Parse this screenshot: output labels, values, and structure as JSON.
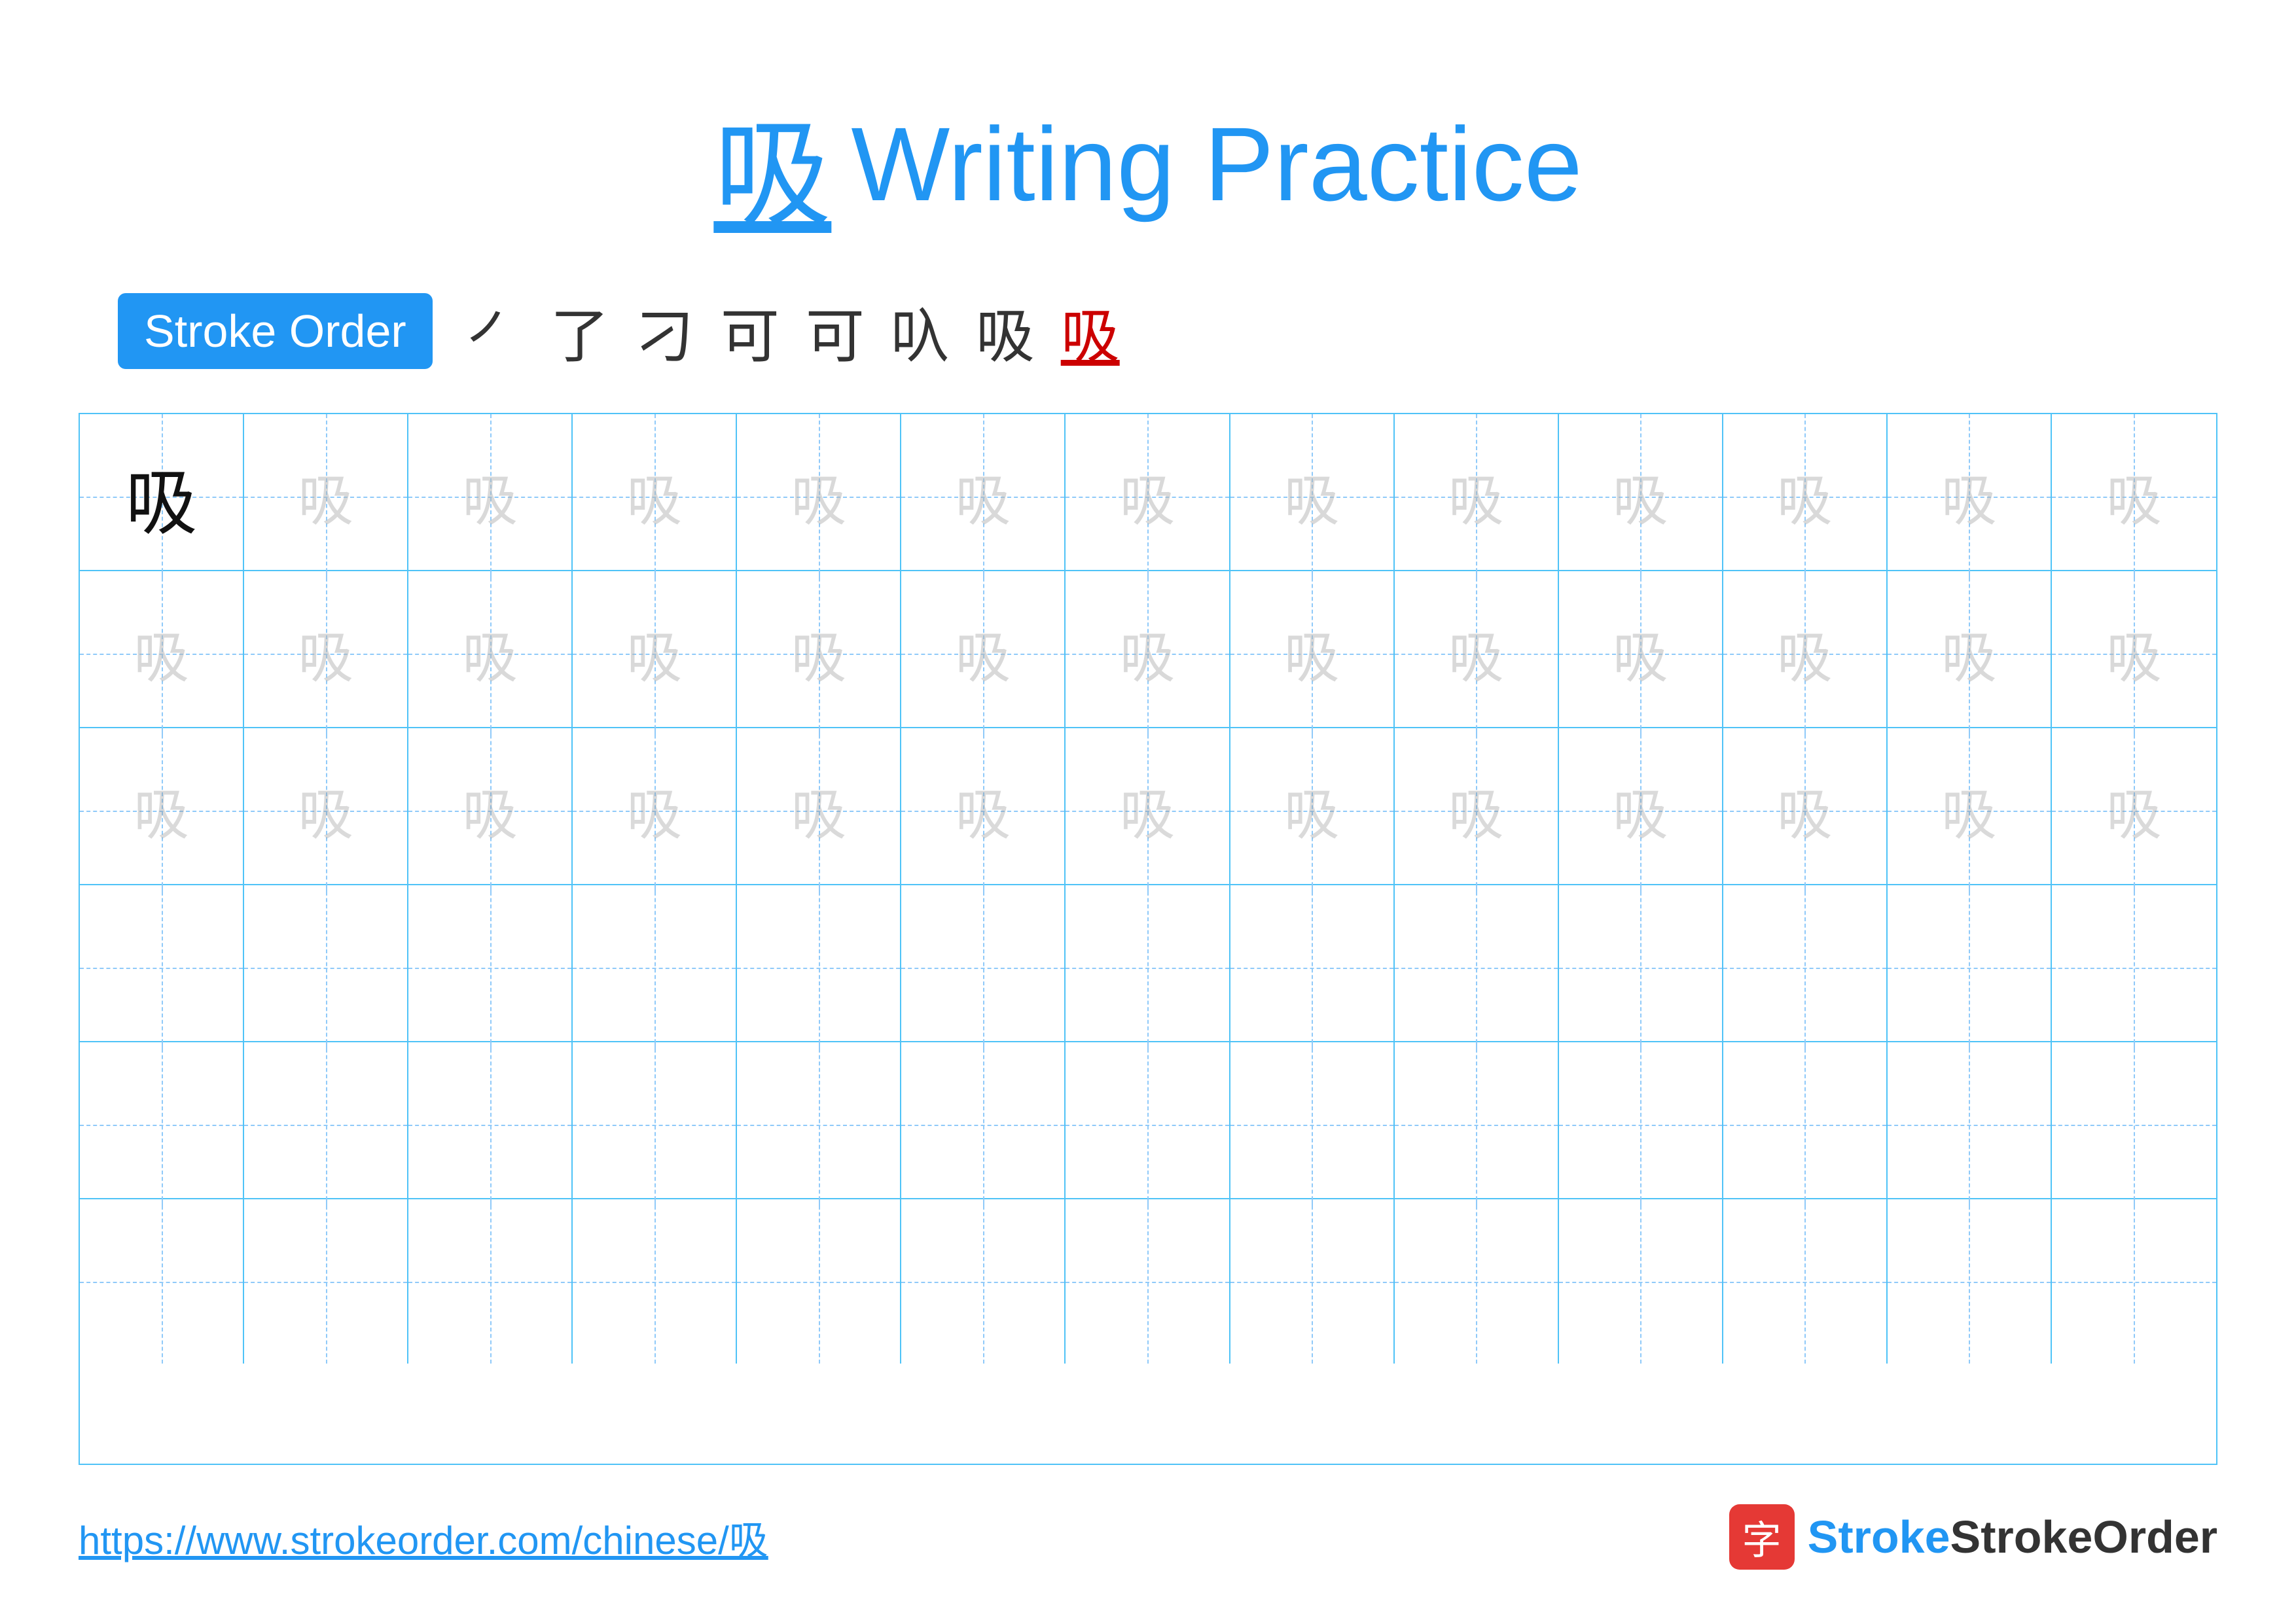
{
  "title": {
    "char": "吸",
    "label": "Writing Practice"
  },
  "stroke_order": {
    "badge_label": "Stroke Order",
    "steps": [
      "㇒",
      "了",
      "刁",
      "可",
      "可",
      "叺",
      "吸",
      "吸"
    ]
  },
  "grid": {
    "rows": 6,
    "cols": 13,
    "row1_type": "reference_ghost",
    "row2_type": "ghost",
    "row3_type": "light",
    "row4_type": "empty",
    "row5_type": "empty",
    "row6_type": "empty"
  },
  "footer": {
    "url": "https://www.strokeorder.com/chinese/吸",
    "logo_icon": "字",
    "logo_text": "StrokeOrder"
  }
}
